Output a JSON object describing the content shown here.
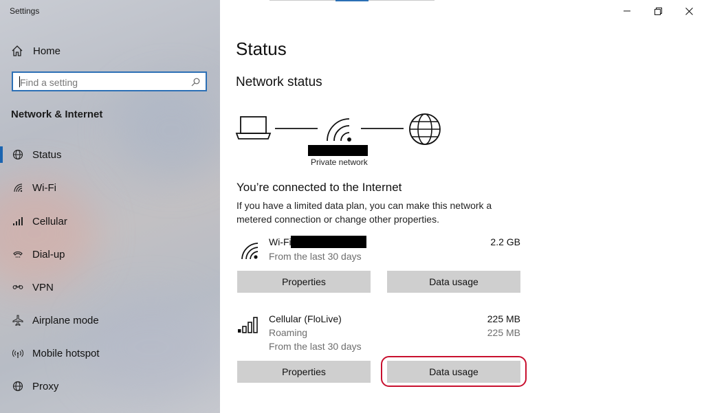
{
  "window": {
    "app_title": "Settings"
  },
  "sidebar": {
    "home_label": "Home",
    "search_placeholder": "Find a setting",
    "section_title": "Network & Internet",
    "items": [
      {
        "label": "Status",
        "icon": "globe-icon",
        "active": true
      },
      {
        "label": "Wi-Fi",
        "icon": "wifi-icon"
      },
      {
        "label": "Cellular",
        "icon": "cellular-icon"
      },
      {
        "label": "Dial-up",
        "icon": "dialup-icon"
      },
      {
        "label": "VPN",
        "icon": "vpn-icon"
      },
      {
        "label": "Airplane mode",
        "icon": "airplane-icon"
      },
      {
        "label": "Mobile hotspot",
        "icon": "hotspot-icon"
      },
      {
        "label": "Proxy",
        "icon": "globe-icon"
      }
    ]
  },
  "main": {
    "page_title": "Status",
    "network_status_heading": "Network status",
    "network_type_label": "Private network",
    "connected_heading": "You’re connected to the Internet",
    "description": "If you have a limited data plan, you can make this network a metered connection or change other properties.",
    "connections": [
      {
        "name": "Wi-Fi",
        "icon": "wifi-icon",
        "sublines": [
          "From the last 30 days"
        ],
        "amounts": [
          "2.2 GB"
        ],
        "properties_label": "Properties",
        "data_usage_label": "Data usage"
      },
      {
        "name": "Cellular (FloLive)",
        "icon": "cellular-signal-icon",
        "sublines": [
          "Roaming",
          "From the last 30 days"
        ],
        "amounts": [
          "225 MB",
          "225 MB"
        ],
        "properties_label": "Properties",
        "data_usage_label": "Data usage"
      }
    ]
  },
  "colors": {
    "accent": "#1a64b0",
    "highlight": "#c8102e",
    "button_bg": "#cfcfcf"
  }
}
